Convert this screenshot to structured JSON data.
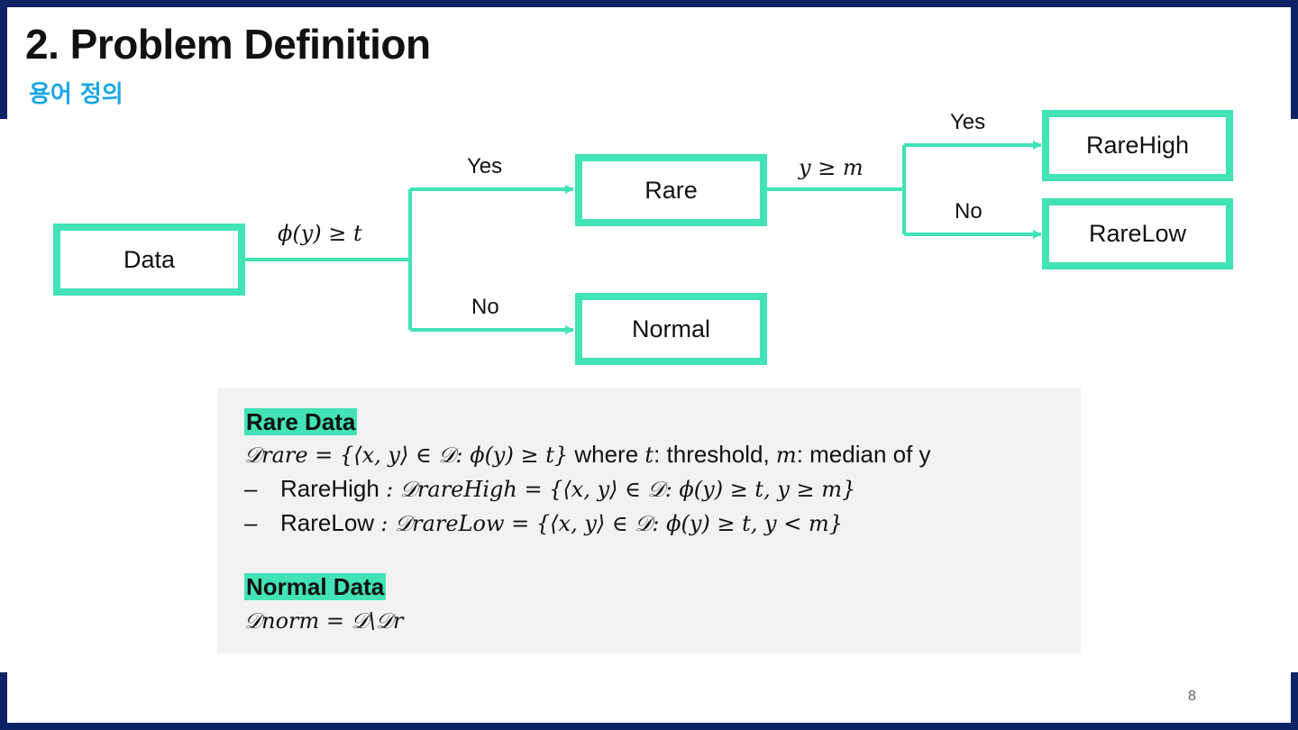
{
  "slide": {
    "title": "2. Problem Definition",
    "subtitle": "용어 정의",
    "page_number": "8"
  },
  "diagram": {
    "nodes": {
      "data": "Data",
      "rare": "Rare",
      "normal": "Normal",
      "rare_high": "RareHigh",
      "rare_low": "RareLow"
    },
    "edges": {
      "condition_rare": "ϕ(y) ≥ t",
      "yes_rare": "Yes",
      "no_normal": "No",
      "condition_high": "y ≥ m",
      "yes_high": "Yes",
      "no_low": "No"
    },
    "colors": {
      "node_border": "#42e3b4",
      "arrow": "#42e3b4"
    }
  },
  "definitions": {
    "rare_heading": "Rare Data",
    "rare_formula": "𝒟rare = {⟨x, y⟩ ∈ 𝒟: ϕ(y) ≥ t}",
    "rare_where": " where ",
    "rare_t": "t",
    "rare_t_desc": ": threshold, ",
    "rare_m": "m",
    "rare_m_desc": ": median of y",
    "rare_high_dash": "–",
    "rare_high_label": "RareHigh ",
    "rare_high_formula": ": 𝒟rareHigh = {⟨x, y⟩ ∈ 𝒟: ϕ(y) ≥ t, y ≥ m}",
    "rare_low_dash": "–",
    "rare_low_label": "RareLow ",
    "rare_low_formula": ": 𝒟rareLow = {⟨x, y⟩ ∈ 𝒟: ϕ(y) ≥ t, y < m}",
    "normal_heading": "Normal Data",
    "normal_formula": "𝒟norm = 𝒟\\𝒟r",
    "colors": {
      "highlight": "#42e3b4",
      "panel_bg": "#f2f2f2"
    }
  }
}
